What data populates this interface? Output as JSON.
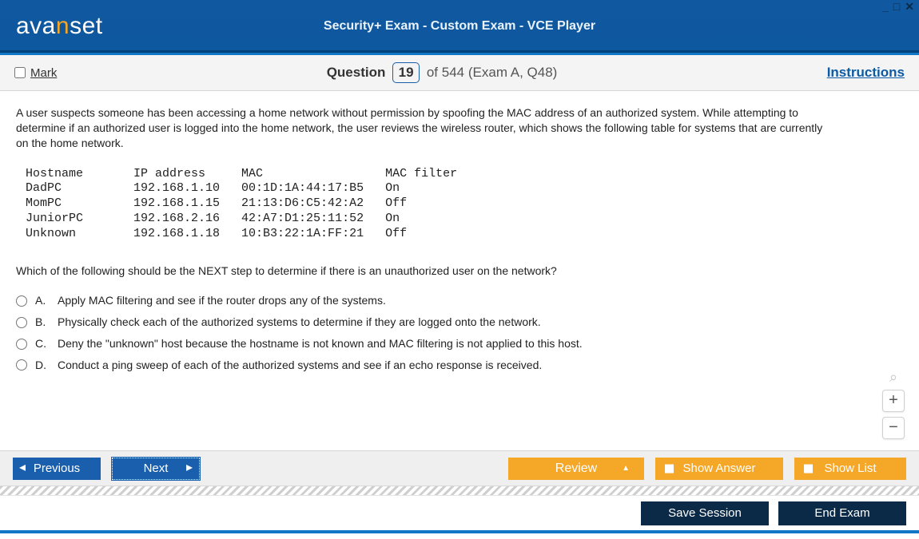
{
  "window": {
    "logo_left": "ava",
    "logo_accent": "n",
    "logo_right": "set",
    "title": "Security+ Exam - Custom Exam - VCE Player",
    "min": "_",
    "max": "□",
    "close": "✕"
  },
  "infobar": {
    "mark_label": "Mark",
    "question_word": "Question",
    "current": "19",
    "of_word": "of",
    "total": "544",
    "context": "(Exam A, Q48)",
    "instructions": "Instructions"
  },
  "question": {
    "stem": "A user suspects someone has been accessing a home network without permission by spoofing the MAC address of an authorized system. While attempting to determine if an authorized user is logged into the home network, the user reviews the wireless router, which shows the following table for systems that are currently on the home network.",
    "table_text": "Hostname       IP address     MAC                 MAC filter\nDadPC          192.168.1.10   00:1D:1A:44:17:B5   On\nMomPC          192.168.1.15   21:13:D6:C5:42:A2   Off\nJuniorPC       192.168.2.16   42:A7:D1:25:11:52   On\nUnknown        192.168.1.18   10:B3:22:1A:FF:21   Off",
    "followup": "Which of the following should be the NEXT step to determine if there is an unauthorized user on the network?",
    "answers": {
      "a": "Apply MAC filtering and see if the router drops any of the systems.",
      "b": "Physically check each of the authorized systems to determine if they are logged onto the network.",
      "c": "Deny the \"unknown\" host because the hostname is not known and MAC filtering is not applied to this host.",
      "d": "Conduct a ping sweep of each of the authorized systems and see if an echo response is received."
    },
    "letters": {
      "a": "A.",
      "b": "B.",
      "c": "C.",
      "d": "D."
    }
  },
  "toolbar": {
    "previous": "Previous",
    "next": "Next",
    "review": "Review",
    "show_answer": "Show Answer",
    "show_list": "Show List",
    "save_session": "Save Session",
    "end_exam": "End Exam"
  },
  "zoom": {
    "search": "⌕",
    "plus": "+",
    "minus": "−"
  }
}
